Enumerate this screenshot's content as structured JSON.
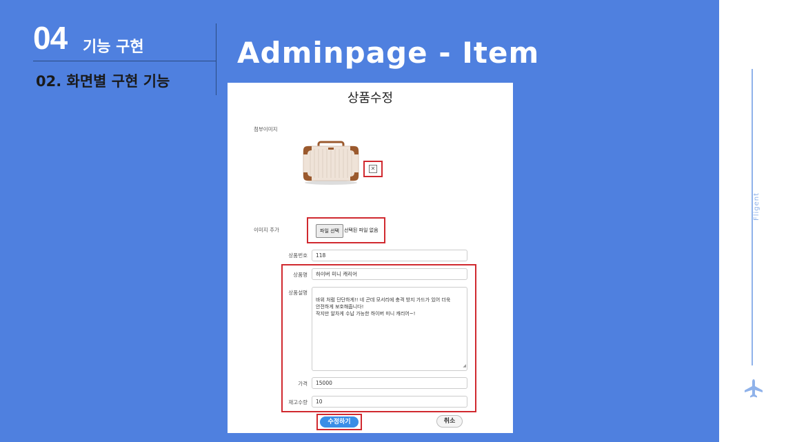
{
  "header": {
    "section_number": "04",
    "section_title": "기능 구현",
    "subsection": "02. 화면별 구현 기능",
    "page_title": "Adminpage - Item"
  },
  "sidebar": {
    "brand": "Fligent"
  },
  "form": {
    "title": "상품수정",
    "attached_image_label": "첨부이미지",
    "delete_icon": "close-box-icon",
    "add_image_label": "이미지 추가",
    "file_button_label": "파일 선택",
    "file_status": "선택된 파일 없음",
    "fields": {
      "item_no_label": "상품번호",
      "item_no_value": "118",
      "name_label": "상품명",
      "name_value": "하이버 미니 캐리어",
      "desc_label": "상품설명",
      "desc_value": "바위 처럼 단단하게!! 네 곤데 모서리에 충격 방지 가드가 있어 더욱\n안전하게 보호해줍니다!\n작지만 알차게 수납 가능한 하이버 미니 캐리어~!",
      "price_label": "가격",
      "price_value": "15000",
      "stock_label": "재고수량",
      "stock_value": "10"
    },
    "submit_label": "수정하기",
    "cancel_label": "취소"
  },
  "colors": {
    "background": "#4f80df",
    "highlight": "#d0282e",
    "primary_button": "#3a8ee6"
  }
}
